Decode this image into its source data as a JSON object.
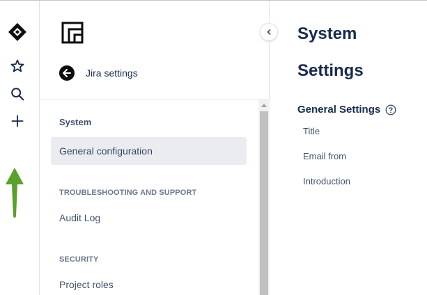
{
  "rail": {
    "icons": [
      "jira-logo-icon",
      "star-icon",
      "search-icon",
      "plus-icon",
      "green-arrow-annotation-icon"
    ]
  },
  "sidebar": {
    "back_label": "Jira settings",
    "heading": "System",
    "items": [
      {
        "label": "General configuration",
        "active": true
      },
      {
        "label": "Audit Log",
        "active": false
      },
      {
        "label": "Project roles",
        "active": false
      }
    ],
    "sections": [
      "TROUBLESHOOTING AND SUPPORT",
      "SECURITY"
    ]
  },
  "main": {
    "title_line1": "System",
    "title_line2": "Settings",
    "section_title": "General Settings",
    "fields": [
      "Title",
      "Email from",
      "Introduction"
    ]
  },
  "colors": {
    "text_primary": "#172b4d",
    "text_secondary": "#42526e",
    "active_bg": "#ebecf0",
    "annotation_arrow": "#5aa02c"
  }
}
